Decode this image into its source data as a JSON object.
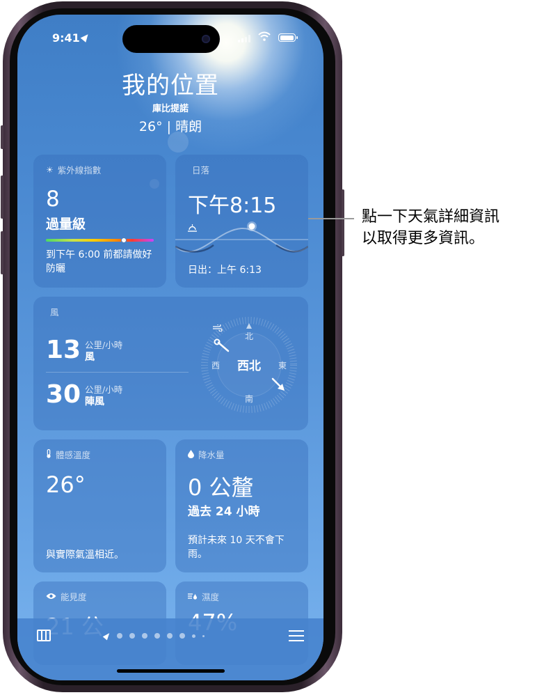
{
  "status": {
    "time": "9:41"
  },
  "location": {
    "title": "我的位置",
    "city": "庫比提諾",
    "condition": "26° | 晴朗"
  },
  "uv": {
    "label": "紫外線指數",
    "value": "8",
    "level": "過量級",
    "note": "到下午 6:00 前都請做好防曬",
    "level_fraction": 0.72
  },
  "sunset": {
    "label": "日落",
    "time": "下午8:15",
    "sunrise": "日出：上午 6:13"
  },
  "wind": {
    "label": "風",
    "speed": "13",
    "speed_unit": "公里/小時",
    "speed_label": "風",
    "gust": "30",
    "gust_unit": "公里/小時",
    "gust_label": "陣風",
    "direction": "西北",
    "compass": {
      "n": "北",
      "e": "東",
      "s": "南",
      "w": "西"
    }
  },
  "feels_like": {
    "label": "體感溫度",
    "value": "26°",
    "note": "與實際氣溫相近。"
  },
  "precipitation": {
    "label": "降水量",
    "value": "0 公釐",
    "period": "過去 24 小時",
    "note": "預計未來 10 天不會下雨。"
  },
  "visibility": {
    "label": "能見度",
    "value": "21 公"
  },
  "humidity": {
    "label": "濕度",
    "value": "47%"
  },
  "callout": {
    "line1": "點一下天氣詳細資訊",
    "line2": "以取得更多資訊。"
  },
  "colors": {
    "sky_top": "#3f7ec6",
    "sky_bottom": "#7ab4ee",
    "card": "#376eb9"
  },
  "icons": [
    "location-arrow-icon",
    "signal-icon",
    "wifi-icon",
    "battery-icon",
    "sun-icon",
    "sunset-icon",
    "wind-icon",
    "thermometer-icon",
    "drop-icon",
    "eye-icon",
    "humidity-icon",
    "map-icon",
    "list-icon"
  ]
}
